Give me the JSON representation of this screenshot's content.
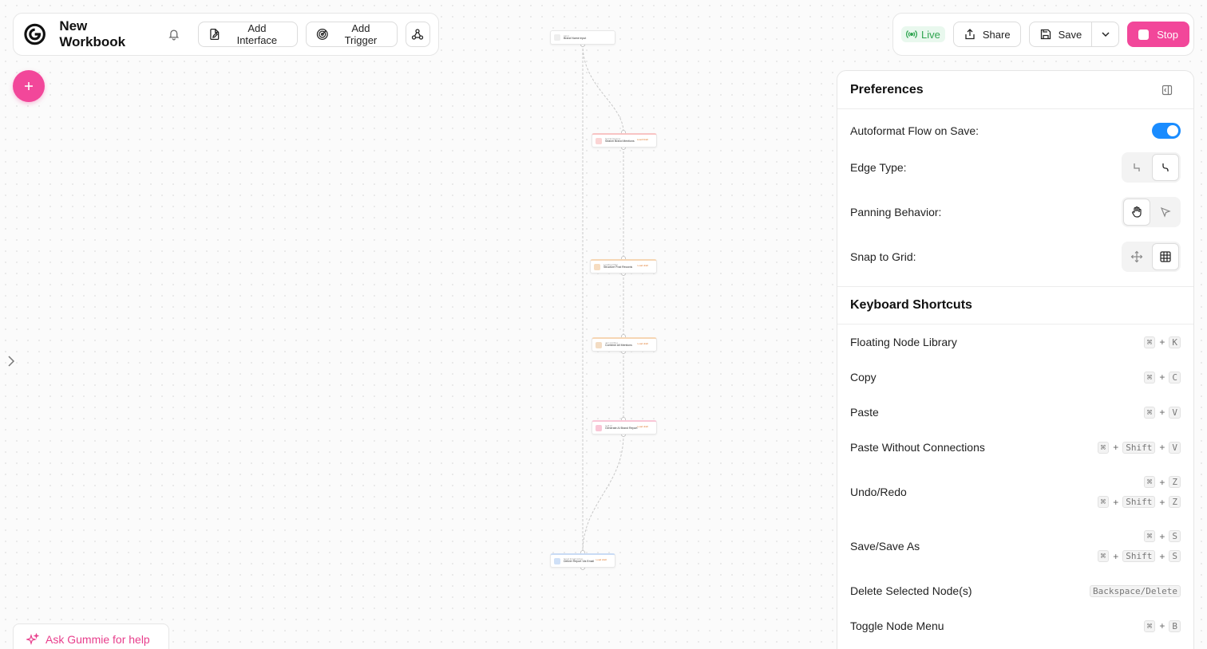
{
  "header": {
    "workbook_title": "New Workbook",
    "add_interface_label": "Add Interface",
    "add_trigger_label": "Add Trigger",
    "live_label": "Live",
    "share_label": "Share",
    "save_label": "Save",
    "stop_label": "Stop"
  },
  "colors": {
    "accent_pink": "#f2479a",
    "toggle_blue": "#1a8cff",
    "live_green": "#2ea44f"
  },
  "fab": {
    "add_label": "+"
  },
  "ask_gummie_label": "Ask Gummie for help",
  "flow": {
    "nodes": [
      {
        "type": "Input",
        "label": "Brand Name input",
        "badge": ""
      },
      {
        "type": "Social Scraper",
        "label": "Search Brand Mentions",
        "badge": "Load Draft"
      },
      {
        "type": "Loading Filter",
        "label": "Structure Post Records",
        "badge": "Load draft"
      },
      {
        "type": "Join & Filter",
        "label": "Combine All Mentions",
        "badge": "Load draft"
      },
      {
        "type": "Call AI",
        "label": "Generate AI Brand Report",
        "badge": "Load draft"
      },
      {
        "type": "Send Email Action",
        "label": "Deliver Report Via Email",
        "badge": "Load draft"
      }
    ]
  },
  "preferences": {
    "title": "Preferences",
    "autoformat_label": "Autoformat Flow on Save:",
    "autoformat_on": true,
    "edge_type_label": "Edge Type:",
    "edge_type_selected": "curved",
    "panning_label": "Panning Behavior:",
    "panning_selected": "hand",
    "snap_label": "Snap to Grid:",
    "snap_selected": "grid"
  },
  "shortcuts": {
    "title": "Keyboard Shortcuts",
    "items": [
      {
        "label": "Floating Node Library",
        "combos": [
          [
            "⌘",
            "K"
          ]
        ]
      },
      {
        "label": "Copy",
        "combos": [
          [
            "⌘",
            "C"
          ]
        ]
      },
      {
        "label": "Paste",
        "combos": [
          [
            "⌘",
            "V"
          ]
        ]
      },
      {
        "label": "Paste Without Connections",
        "combos": [
          [
            "⌘",
            "Shift",
            "V"
          ]
        ]
      },
      {
        "label": "Undo/Redo",
        "combos": [
          [
            "⌘",
            "Z"
          ],
          [
            "⌘",
            "Shift",
            "Z"
          ]
        ]
      },
      {
        "label": "Save/Save As",
        "combos": [
          [
            "⌘",
            "S"
          ],
          [
            "⌘",
            "Shift",
            "S"
          ]
        ]
      },
      {
        "label": "Delete Selected Node(s)",
        "combos": [
          [
            "Backspace/Delete"
          ]
        ]
      },
      {
        "label": "Toggle Node Menu",
        "combos": [
          [
            "⌘",
            "B"
          ]
        ]
      }
    ]
  }
}
